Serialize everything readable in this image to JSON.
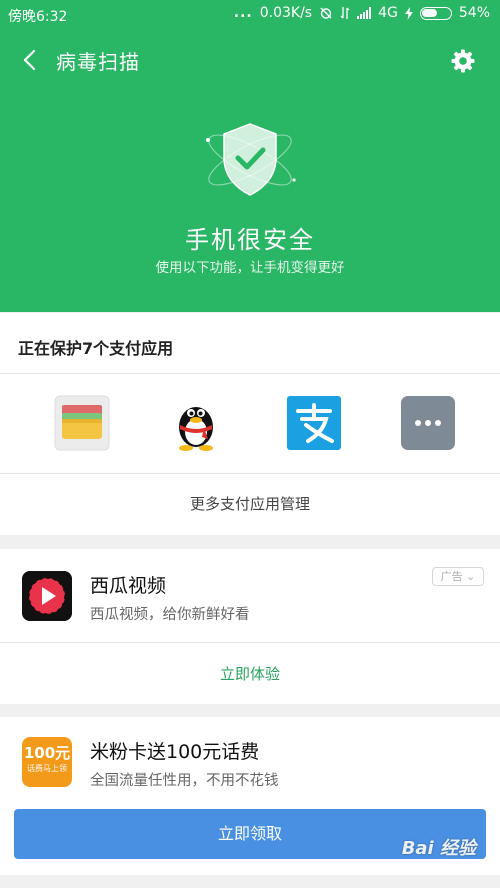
{
  "status_bar": {
    "time": "傍晚6:32",
    "dots": "...",
    "speed": "0.03K/s",
    "network": "4G",
    "battery": "54%"
  },
  "header": {
    "title": "病毒扫描",
    "safe_title": "手机很安全",
    "safe_subtitle": "使用以下功能，让手机变得更好",
    "bg_color": "#29b665"
  },
  "payment": {
    "title": "正在保护7个支付应用",
    "icons": [
      "wallet-app-icon",
      "qq-app-icon",
      "alipay-app-icon",
      "more-apps-icon"
    ],
    "manage_label": "更多支付应用管理"
  },
  "ad": {
    "name": "西瓜视频",
    "desc": "西瓜视频，给你新鲜好看",
    "tag": "广告",
    "action": "立即体验"
  },
  "promo": {
    "icon_big": "100元",
    "icon_small": "话费马上领",
    "name": "米粉卡送100元话费",
    "desc": "全国流量任性用，不用不花钱",
    "button": "立即领取",
    "accent": "#4a90e2"
  },
  "watermark": "Bai 经验"
}
